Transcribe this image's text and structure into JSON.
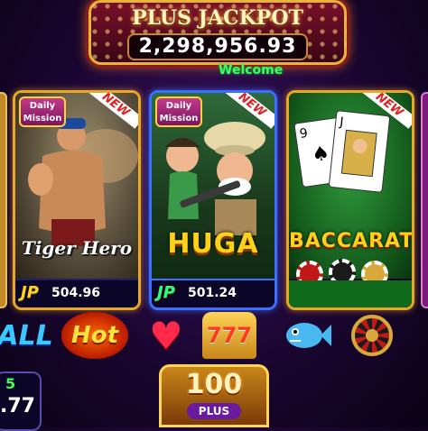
{
  "jackpot": {
    "title": "PLUS JACKPOT",
    "value": "2,298,956.93"
  },
  "welcome": "Welcome",
  "cards": [
    {
      "id": "tiger",
      "title": "Tiger Hero",
      "daily": "Daily Mission",
      "badge": "NEW",
      "jp_label": "JP",
      "jp_value": "504.96"
    },
    {
      "id": "huga",
      "title": "HUGA",
      "daily": "Daily Mission",
      "badge": "NEW",
      "jp_label": "JP",
      "jp_value": "501.24"
    },
    {
      "id": "baccarat",
      "title": "BACCARAT",
      "badge": "NEW"
    }
  ],
  "categories": {
    "all": "ALL",
    "hot": "Hot",
    "heart_icon": "heart-icon",
    "slots": "777",
    "fish_icon": "fish-icon",
    "roulette_icon": "roulette-icon"
  },
  "plus100": {
    "number": "100",
    "label": "PLUS"
  },
  "balance": {
    "line1": "5",
    "line2": ".77"
  },
  "colors": {
    "gold": "#e7a826",
    "welcome_green": "#3cff5a",
    "jp_yellow": "#ffd21a"
  }
}
